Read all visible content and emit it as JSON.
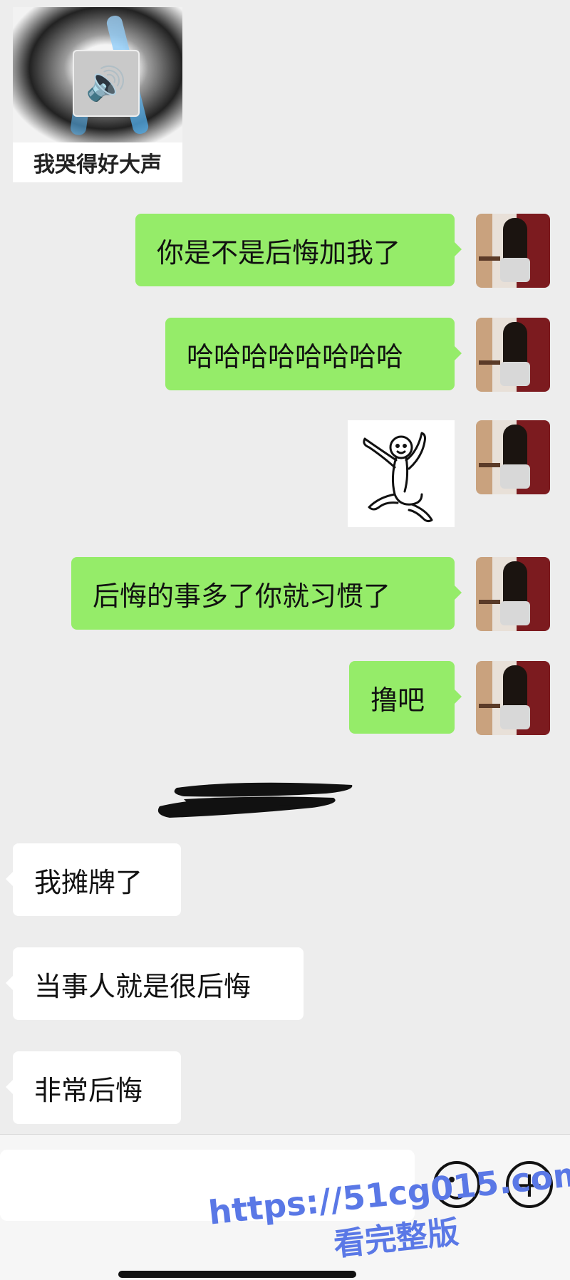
{
  "messages": {
    "top_sticker": {
      "caption": "我哭得好大声"
    },
    "outgoing": [
      "你是不是后悔加我了",
      "哈哈哈哈哈哈哈哈",
      "后悔的事多了你就习惯了",
      "撸吧"
    ],
    "incoming": [
      "我摊牌了",
      "当事人就是很后悔",
      "非常后悔"
    ]
  },
  "input": {
    "value": "",
    "emoji_icon": "smile-icon",
    "plus_icon": "plus-icon",
    "plus_glyph": "+"
  },
  "watermark": {
    "url": "https://51cg015.com",
    "subtitle": "看完整版"
  },
  "colors": {
    "outgoing_bubble": "#95ec69",
    "incoming_bubble": "#ffffff",
    "background": "#ededed",
    "watermark": "#5a78e6"
  }
}
